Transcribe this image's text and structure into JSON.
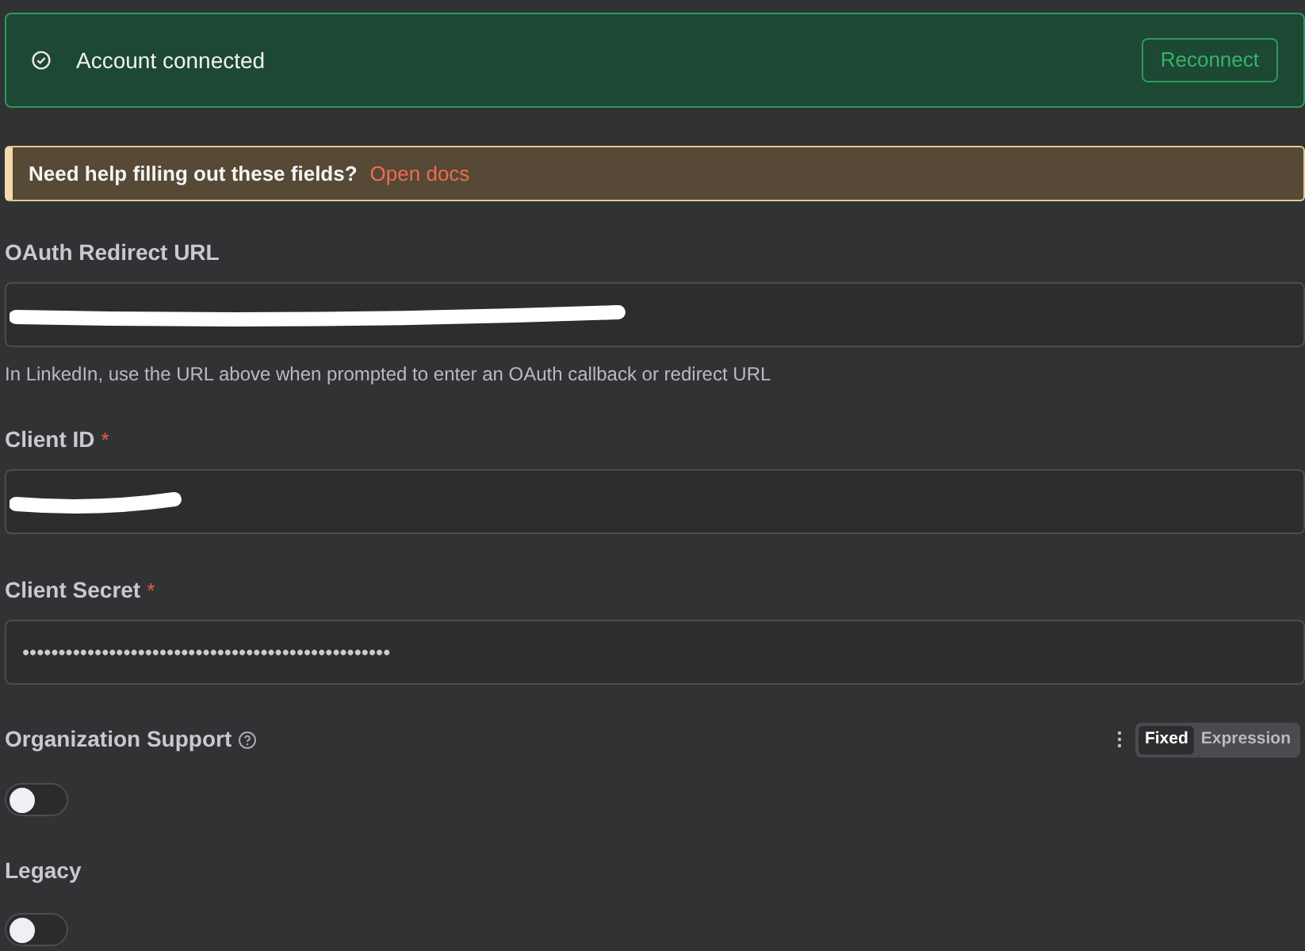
{
  "connection": {
    "status": "Account connected",
    "action": "Reconnect"
  },
  "help": {
    "text": "Need help filling out these fields?",
    "link": "Open docs"
  },
  "fields": [
    {
      "kind": "text",
      "label": "OAuth Redirect URL",
      "redacted": true,
      "hint": "In LinkedIn, use the URL above when prompted to enter an OAuth callback or redirect URL"
    },
    {
      "kind": "text",
      "label": "Client ID",
      "required_mark": "*",
      "redacted": true
    },
    {
      "kind": "text",
      "label": "Client Secret",
      "required_mark": "*",
      "value": "•••••••••••••••••••••••••••••••••••••••••••••••••••"
    },
    {
      "kind": "toggle",
      "label": "Organization Support",
      "info": true,
      "on": false,
      "modes": [
        {
          "label": "Fixed",
          "selected": true
        },
        {
          "label": "Expression",
          "selected": false
        }
      ]
    },
    {
      "kind": "toggle",
      "label": "Legacy",
      "on": false
    }
  ]
}
